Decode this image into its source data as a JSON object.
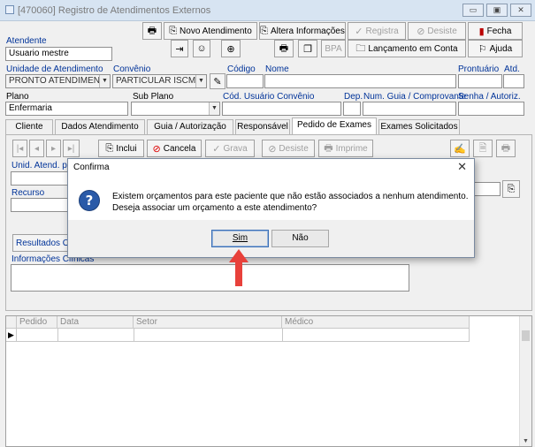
{
  "window": {
    "title": "[470060] Registro de Atendimentos Externos",
    "controls": {
      "minimize": "▭",
      "maximize": "▣",
      "close": "✕"
    }
  },
  "toolbar": {
    "novo_atendimento": "Novo Atendimento",
    "altera_informacoes": "Altera Informações",
    "registra": "Registra",
    "desiste": "Desiste",
    "fecha": "Fecha",
    "bpa": "BPA",
    "lancamento_em_conta": "Lançamento em Conta",
    "ajuda": "Ajuda"
  },
  "form": {
    "atendente_label": "Atendente",
    "atendente_value": "Usuario mestre",
    "unidade_label": "Unidade de Atendimento",
    "unidade_value": "PRONTO ATENDIMENT",
    "convenio_label": "Convênio",
    "convenio_value": "PARTICULAR ISCMC",
    "codigo_label": "Código",
    "nome_label": "Nome",
    "prontuario_label": "Prontuário",
    "atd_label": "Atd.",
    "plano_label": "Plano",
    "plano_value": "Enfermaria",
    "subplano_label": "Sub Plano",
    "cod_usuario_label": "Cód. Usuário Convênio",
    "dep_label": "Dep.",
    "num_guia_label": "Num. Guia / Comprovante",
    "senha_label": "Senha / Autoriz."
  },
  "tabs": [
    {
      "label": "Cliente"
    },
    {
      "label": "Dados Atendimento"
    },
    {
      "label": "Guia / Autorização"
    },
    {
      "label": "Responsável"
    },
    {
      "label": "Pedido de Exames"
    },
    {
      "label": "Exames Solicitados"
    }
  ],
  "panel": {
    "nav": {
      "first": "|◂",
      "prev": "◂",
      "next": "▸",
      "last": "▸|"
    },
    "inclui": "Inclui",
    "cancela": "Cancela",
    "grava": "Grava",
    "desiste": "Desiste",
    "imprime": "Imprime",
    "unid_atend_label": "Unid. Atend. pa",
    "recurso_label": "Recurso",
    "resultados_label": "Resultados O",
    "informacoes_clinicas_label": "Informações Clínicas"
  },
  "grid": {
    "columns": [
      "Pedido",
      "Data",
      "Setor",
      "Médico"
    ],
    "row_marker": "▶"
  },
  "dialog": {
    "title": "Confirma",
    "close": "✕",
    "icon": "?",
    "line1": "Existem orçamentos para este paciente que não estão associados a nenhum atendimento.",
    "line2": "Deseja associar um orçamento a este atendimento?",
    "sim": "Sim",
    "nao": "Não"
  },
  "colors": {
    "arrow": "#e8413b",
    "accent": "#2a5aa8"
  }
}
